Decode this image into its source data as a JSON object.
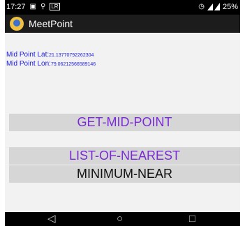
{
  "status_bar": {
    "time": "17:27",
    "notification_badge": "LR",
    "battery_percent": "25%",
    "icons": [
      "image-icon",
      "cast-icon",
      "alarm-icon",
      "signal-icon",
      "battery-icon"
    ]
  },
  "app_bar": {
    "title": "MeetPoint",
    "logo_icon": "meetpoint-logo-icon"
  },
  "midpoint": {
    "lat_label": "Mid Point Lat:",
    "lat_value": "21.13770792262304",
    "lon_label": "Mid Point Lon:",
    "lon_value": "79.06212566589146"
  },
  "buttons": {
    "get_mid_point": "GET-MID-POINT",
    "list_of_nearest": "LIST-OF-NEAREST",
    "minimum_near": "MINIMUM-NEAR"
  },
  "nav_bar": {
    "icons": [
      "back-icon",
      "home-icon",
      "recents-icon"
    ]
  },
  "colors": {
    "accent_purple": "#7b2bd6",
    "coord_blue": "#1a1ae6",
    "button_gray": "#d6d6d6"
  }
}
